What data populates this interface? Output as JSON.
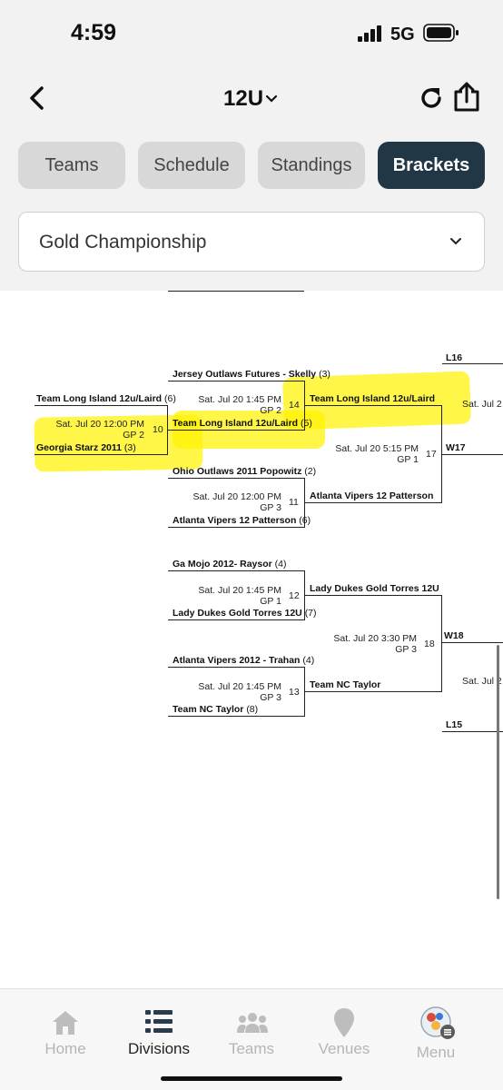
{
  "status": {
    "time": "4:59",
    "network": "5G"
  },
  "header": {
    "title": "12U"
  },
  "tabs": [
    {
      "label": "Teams"
    },
    {
      "label": "Schedule"
    },
    {
      "label": "Standings"
    },
    {
      "label": "Brackets"
    }
  ],
  "division_select": {
    "value": "Gold Championship"
  },
  "bracket": {
    "g10": {
      "top": "Team Long Island 12u/Laird",
      "top_seed": "(6)",
      "bottom": "Georgia Starz 2011",
      "bottom_seed": "(3)",
      "time": "Sat. Jul 20 12:00 PM",
      "field": "GP 2",
      "num": "10"
    },
    "g14": {
      "top": "Jersey Outlaws Futures - Skelly",
      "top_seed": "(3)",
      "bottom": "Team Long Island 12u/Laird",
      "bottom_seed": "(5)",
      "time": "Sat. Jul 20 1:45 PM",
      "field": "GP 2",
      "num": "14"
    },
    "g11": {
      "top": "Ohio Outlaws 2011 Popowitz",
      "top_seed": "(2)",
      "bottom": "Atlanta Vipers 12 Patterson",
      "bottom_seed": "(6)",
      "time": "Sat. Jul 20 12:00 PM",
      "field": "GP 3",
      "num": "11"
    },
    "g17": {
      "top": "Team Long Island 12u/Laird",
      "bottom": "Atlanta Vipers 12 Patterson",
      "time": "Sat. Jul 20 5:15 PM",
      "field": "GP 1",
      "num": "17",
      "winner": "W17"
    },
    "g12": {
      "top": "Ga Mojo 2012- Raysor",
      "top_seed": "(4)",
      "bottom": "Lady Dukes Gold Torres 12U",
      "bottom_seed": "(7)",
      "time": "Sat. Jul 20 1:45 PM",
      "field": "GP 1",
      "num": "12"
    },
    "g13": {
      "top": "Atlanta Vipers 2012 - Trahan",
      "top_seed": "(4)",
      "bottom": "Team NC Taylor",
      "bottom_seed": "(8)",
      "time": "Sat. Jul 20 1:45 PM",
      "field": "GP 3",
      "num": "13"
    },
    "g18": {
      "top": "Lady Dukes Gold Torres 12U",
      "bottom": "Team NC Taylor",
      "time": "Sat. Jul 20 3:30 PM",
      "field": "GP 3",
      "num": "18",
      "winner": "W18"
    },
    "l16": "L16",
    "l15": "L15",
    "cut1": "Sat. Jul 2",
    "cut2": "Sat. Jul 2"
  },
  "bottom_nav": [
    {
      "label": "Home"
    },
    {
      "label": "Divisions"
    },
    {
      "label": "Teams"
    },
    {
      "label": "Venues"
    },
    {
      "label": "Menu"
    }
  ],
  "colors": {
    "active_tab": "#213746",
    "highlight": "#fff200"
  }
}
